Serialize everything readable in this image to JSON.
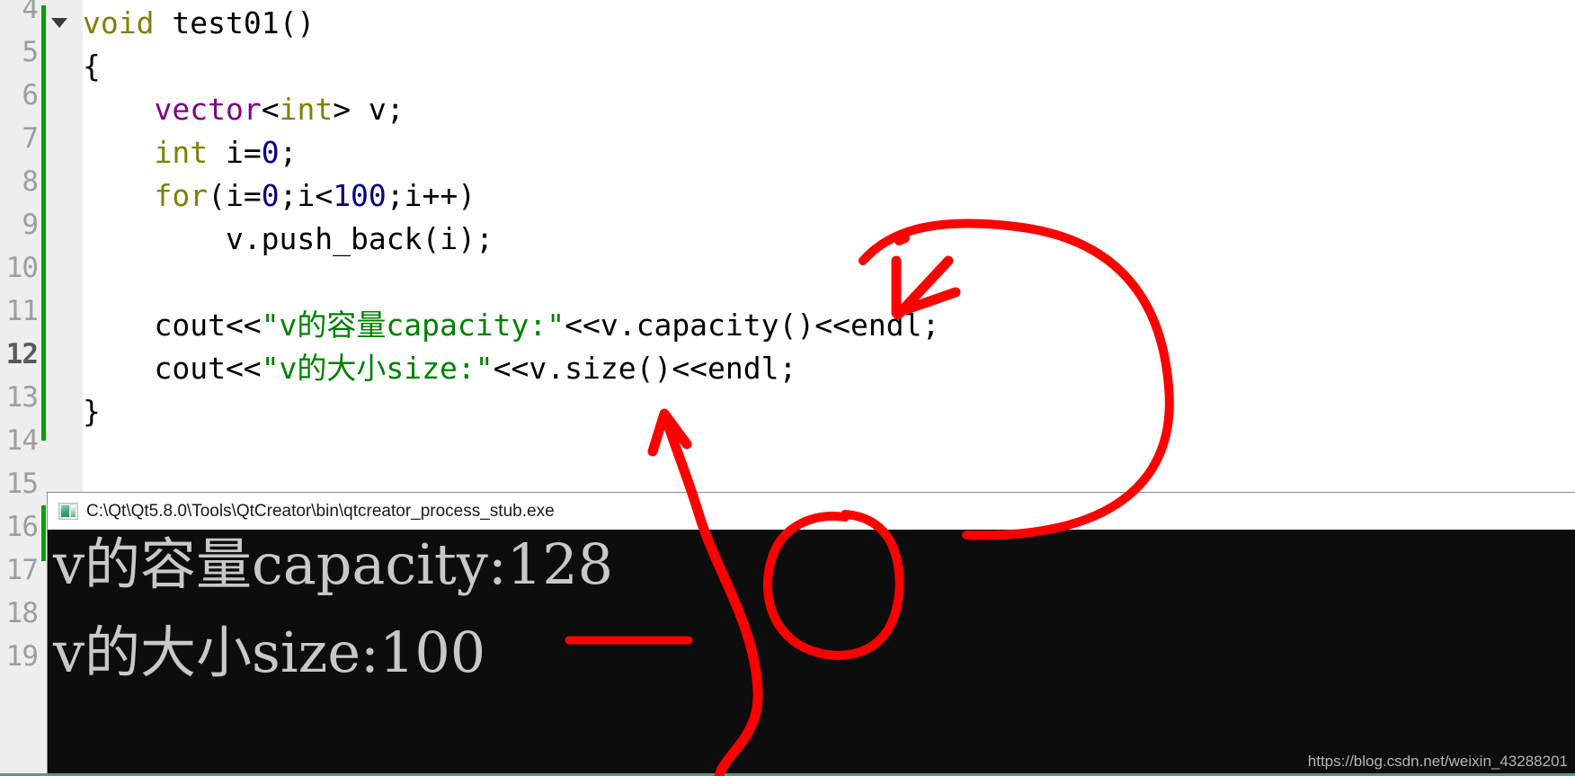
{
  "window": {
    "title": "C:\\Qt\\Qt5.8.0\\Tools\\QtCreator\\bin\\qtcreator_process_stub.exe",
    "icon": "console-window-icon"
  },
  "editor": {
    "language": "C++",
    "current_line": 12,
    "gutter_line_numbers": [
      "4",
      "5",
      "6",
      "7",
      "8",
      "9",
      "10",
      "11",
      "12",
      "13",
      "14",
      "15",
      "16",
      "17",
      "18",
      "19"
    ],
    "fold_marker": "collapse-triangle-icon",
    "lines": [
      {
        "number": "4",
        "tokens": [
          {
            "t": "void",
            "c": "tok-type"
          },
          {
            "t": " ",
            "c": "tok-plain"
          },
          {
            "t": "test01()",
            "c": "tok-plain"
          }
        ]
      },
      {
        "number": "5",
        "tokens": [
          {
            "t": "{",
            "c": "tok-plain"
          }
        ]
      },
      {
        "number": "6",
        "tokens": [
          {
            "t": "    ",
            "c": "tok-plain"
          },
          {
            "t": "vector",
            "c": "tok-class"
          },
          {
            "t": "<",
            "c": "tok-plain"
          },
          {
            "t": "int",
            "c": "tok-type"
          },
          {
            "t": "> v;",
            "c": "tok-plain"
          }
        ]
      },
      {
        "number": "7",
        "tokens": [
          {
            "t": "    ",
            "c": "tok-plain"
          },
          {
            "t": "int",
            "c": "tok-type"
          },
          {
            "t": " i=",
            "c": "tok-plain"
          },
          {
            "t": "0",
            "c": "tok-num"
          },
          {
            "t": ";",
            "c": "tok-plain"
          }
        ]
      },
      {
        "number": "8",
        "tokens": [
          {
            "t": "    ",
            "c": "tok-plain"
          },
          {
            "t": "for",
            "c": "tok-kw"
          },
          {
            "t": "(i=",
            "c": "tok-plain"
          },
          {
            "t": "0",
            "c": "tok-num"
          },
          {
            "t": ";i<",
            "c": "tok-plain"
          },
          {
            "t": "100",
            "c": "tok-num"
          },
          {
            "t": ";i++)",
            "c": "tok-plain"
          }
        ]
      },
      {
        "number": "9",
        "tokens": [
          {
            "t": "        v.push_back(i);",
            "c": "tok-plain"
          }
        ]
      },
      {
        "number": "10",
        "tokens": []
      },
      {
        "number": "11",
        "tokens": [
          {
            "t": "    cout<<",
            "c": "tok-plain"
          },
          {
            "t": "\"v的容量capacity:\"",
            "c": "tok-str"
          },
          {
            "t": "<<v.capacity()<<endl;",
            "c": "tok-plain"
          }
        ]
      },
      {
        "number": "12",
        "tokens": [
          {
            "t": "    cout<<",
            "c": "tok-plain"
          },
          {
            "t": "\"v的大小size:\"",
            "c": "tok-str"
          },
          {
            "t": "<<v.size()<<endl;",
            "c": "tok-plain"
          }
        ]
      },
      {
        "number": "13",
        "tokens": [
          {
            "t": "}",
            "c": "tok-plain"
          }
        ]
      }
    ]
  },
  "console": {
    "output_lines": [
      "v的容量capacity:128",
      "v的大小size:100"
    ],
    "watermark": "https://blog.csdn.net/weixin_43288201"
  },
  "annotations": {
    "color": "#ff0000",
    "items": [
      {
        "name": "arrow-to-capacity-call",
        "kind": "arrow"
      },
      {
        "name": "arrow-to-size-call",
        "kind": "arrow"
      },
      {
        "name": "circle-around-128",
        "kind": "ellipse"
      },
      {
        "name": "underline-under-100",
        "kind": "line"
      },
      {
        "name": "connector-curve",
        "kind": "path"
      }
    ]
  },
  "colors": {
    "gutter_bg": "#eeeeee",
    "change_bar": "#00a000",
    "string_token": "#008000",
    "keyword_token": "#808000",
    "class_token": "#800080",
    "number_token": "#000080",
    "console_bg": "#0d0d0d",
    "console_fg": "#c8c8c8",
    "annotation": "#ff0000",
    "bottom_rule": "#4e9e86"
  }
}
